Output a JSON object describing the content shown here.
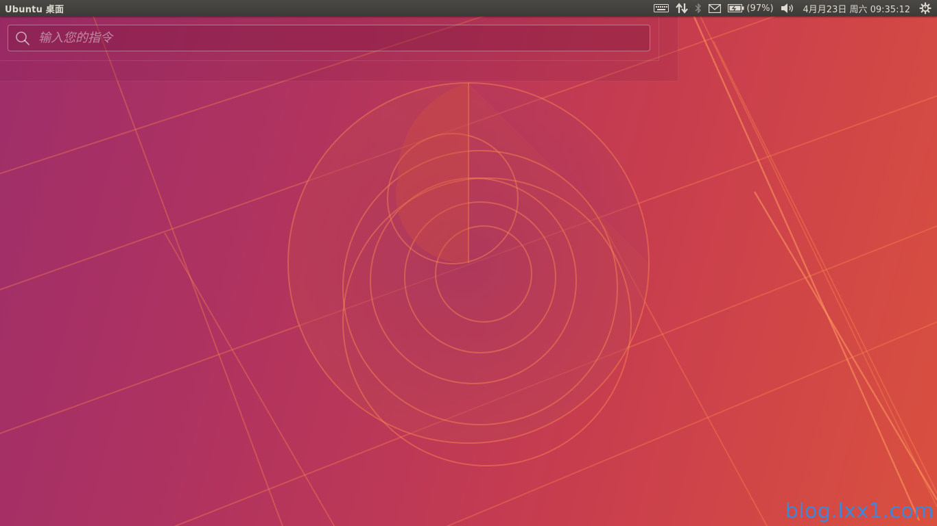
{
  "panel": {
    "title": "Ubuntu 桌面",
    "indicators": {
      "keyboard": "keyboard-icon",
      "network": "network-updown-icon",
      "bluetooth": "bluetooth-icon",
      "mail": "mail-icon",
      "battery_icon": "battery-icon",
      "battery_text": "(97%)",
      "volume": "volume-icon",
      "datetime": "4月月23日 周六 09:35:12",
      "session": "gear-power-icon"
    }
  },
  "dash": {
    "search_placeholder": "输入您的指令",
    "search_value": ""
  },
  "watermark": "blog.lxx1.com",
  "colors": {
    "panel_bg": "#3c3b37",
    "panel_text": "#dfdbd2",
    "wallpaper_magenta": "#9e2e6a",
    "wallpaper_orange": "#d9503f",
    "watermark": "#3f86d6"
  }
}
